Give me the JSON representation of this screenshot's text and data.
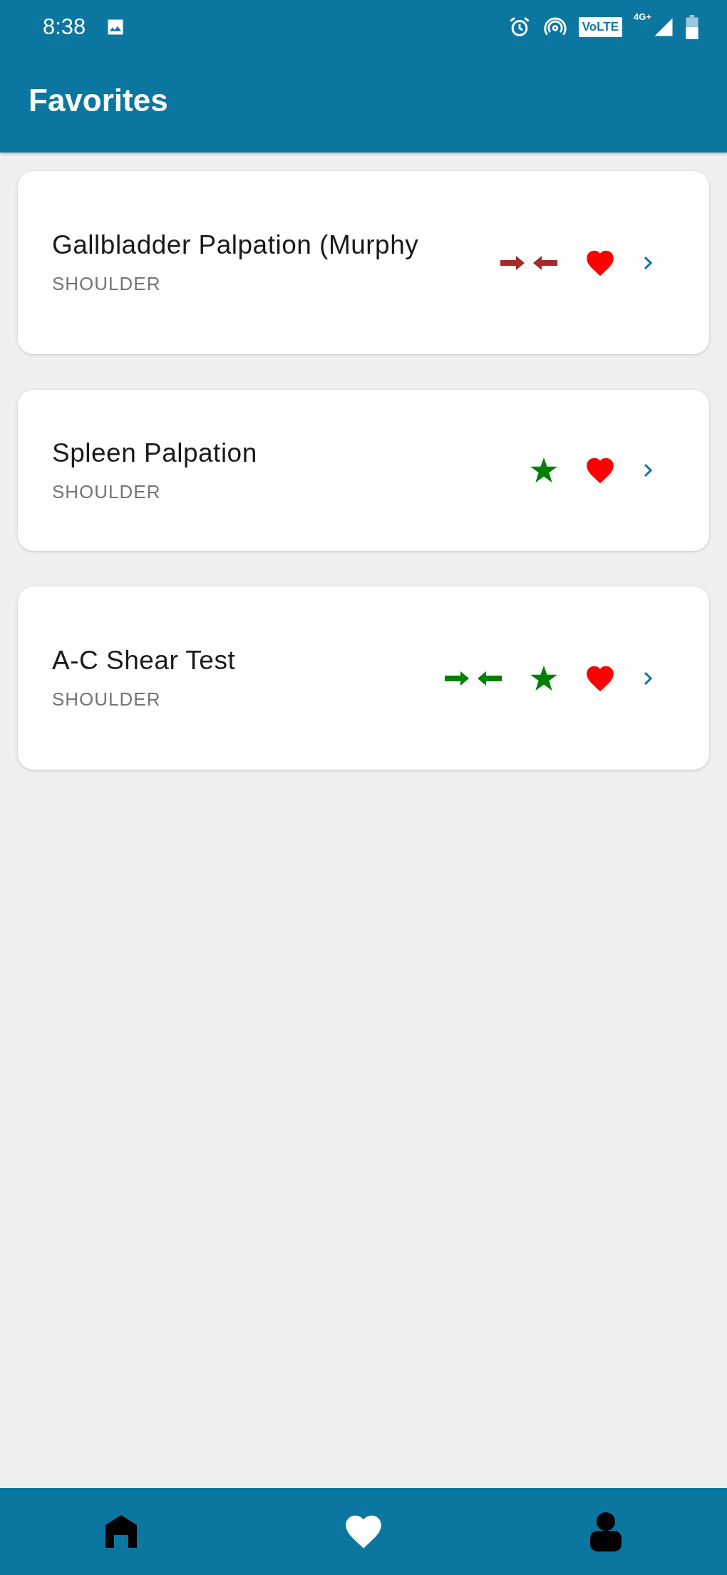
{
  "status_bar": {
    "time": "8:38",
    "volte": "VoLTE",
    "network": "4G+"
  },
  "app_bar": {
    "title": "Favorites"
  },
  "items": [
    {
      "title": "Gallbladder Palpation (Murphy",
      "subtitle": "SHOULDER",
      "arrows": {
        "color": "#a52a2a"
      },
      "starred": false,
      "favorite": true
    },
    {
      "title": "Spleen Palpation",
      "subtitle": "SHOULDER",
      "starred": true,
      "favorite": true
    },
    {
      "title": "A-C Shear Test",
      "subtitle": "SHOULDER",
      "arrows": {
        "color": "#008000"
      },
      "starred": true,
      "favorite": true
    }
  ],
  "bottom_nav": [
    {
      "kind": "home",
      "selected": false
    },
    {
      "kind": "favorites",
      "selected": true
    },
    {
      "kind": "profile",
      "selected": false
    }
  ]
}
